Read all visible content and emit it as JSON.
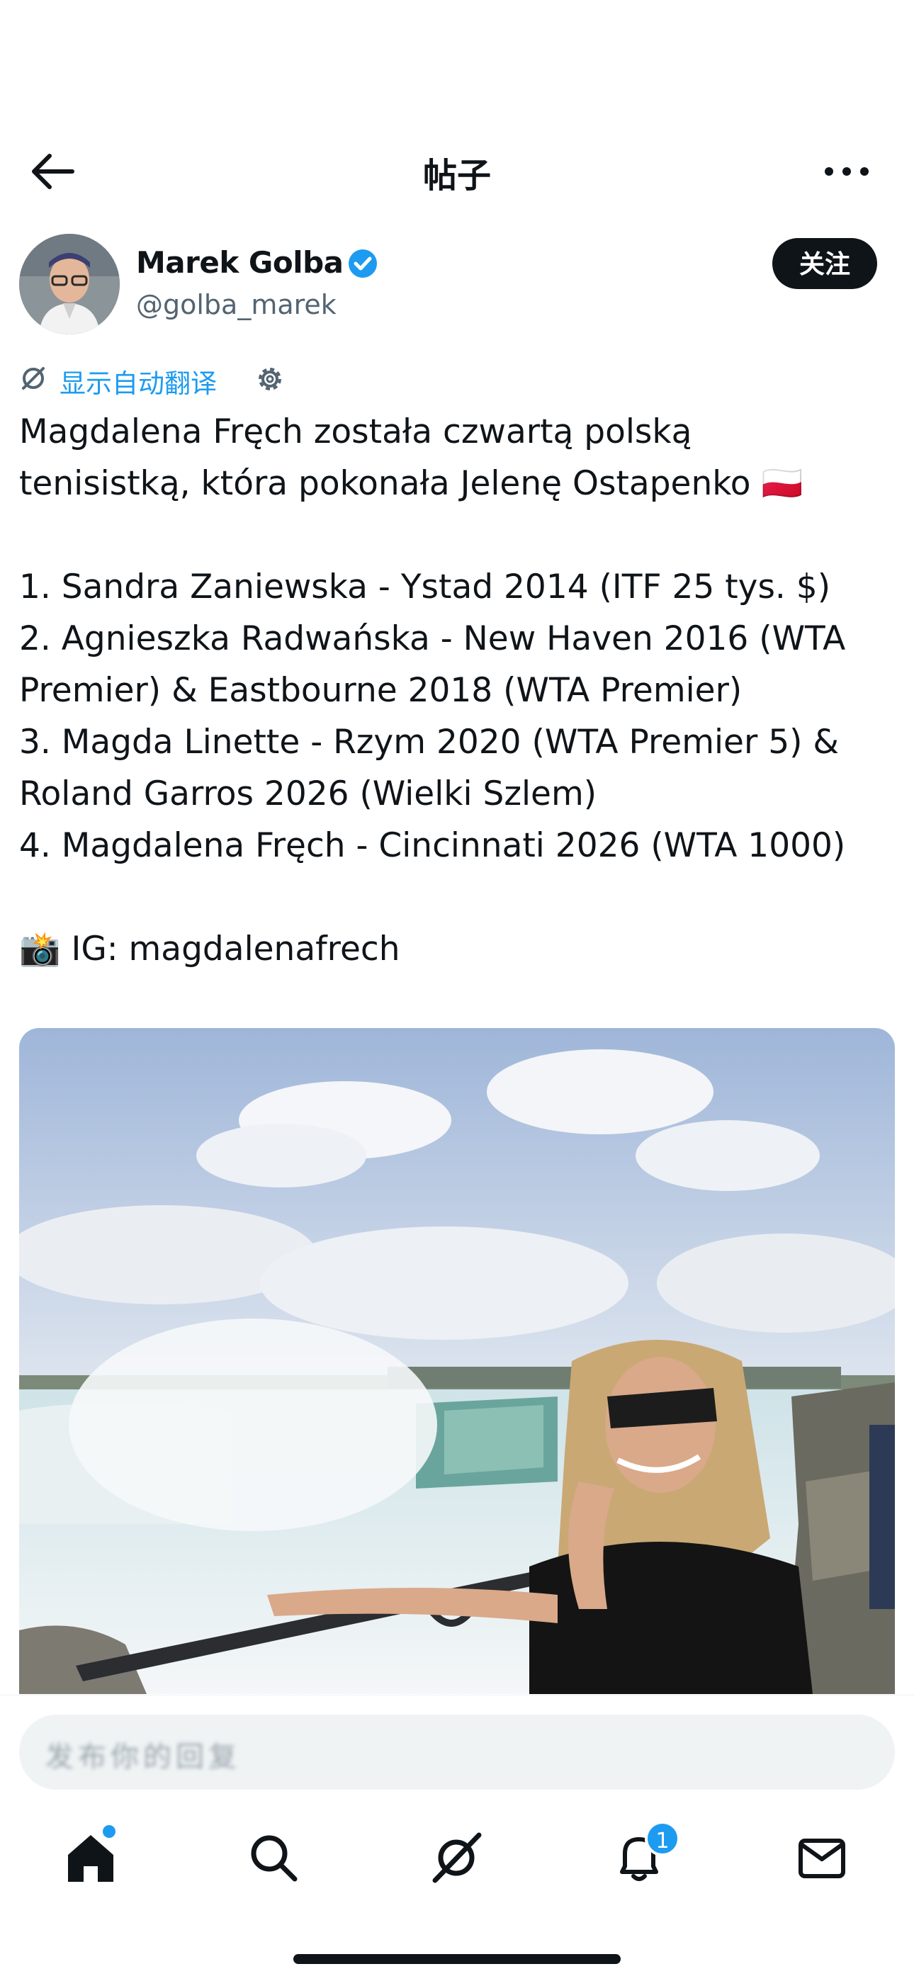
{
  "header": {
    "title": "帖子"
  },
  "author": {
    "display_name": "Marek Golba",
    "handle": "@golba_marek",
    "follow_label": "关注"
  },
  "translate": {
    "label": "显示自动翻译"
  },
  "post": {
    "lines": [
      "Magdalena Fręch została czwartą polską",
      "tenisistką, która pokonała Jelenę Ostapenko 🇵🇱",
      "1. Sandra Zaniewska - Ystad 2014 (ITF 25 tys. $)",
      "2. Agnieszka Radwańska - New Haven 2016 (WTA",
      "Premier) & Eastbourne 2018 (WTA Premier)",
      "3. Magda Linette - Rzym 2020 (WTA Premier 5) &",
      "Roland Garros 2026 (Wielki Szlem)",
      "4. Magdalena Fręch - Cincinnati 2026 (WTA 1000)",
      "📸 IG: magdalenafrech"
    ]
  },
  "reply": {
    "placeholder": "发布你的回复"
  },
  "tabs": [
    {
      "name": "home",
      "icon": "home-icon"
    },
    {
      "name": "search",
      "icon": "search-icon"
    },
    {
      "name": "grok",
      "icon": "grok-icon"
    },
    {
      "name": "notifications",
      "icon": "bell-icon",
      "badge": "1"
    },
    {
      "name": "messages",
      "icon": "mail-icon"
    }
  ],
  "colors": {
    "accent": "#1d9bf0",
    "text": "#0f1419",
    "secondary": "#536471"
  }
}
